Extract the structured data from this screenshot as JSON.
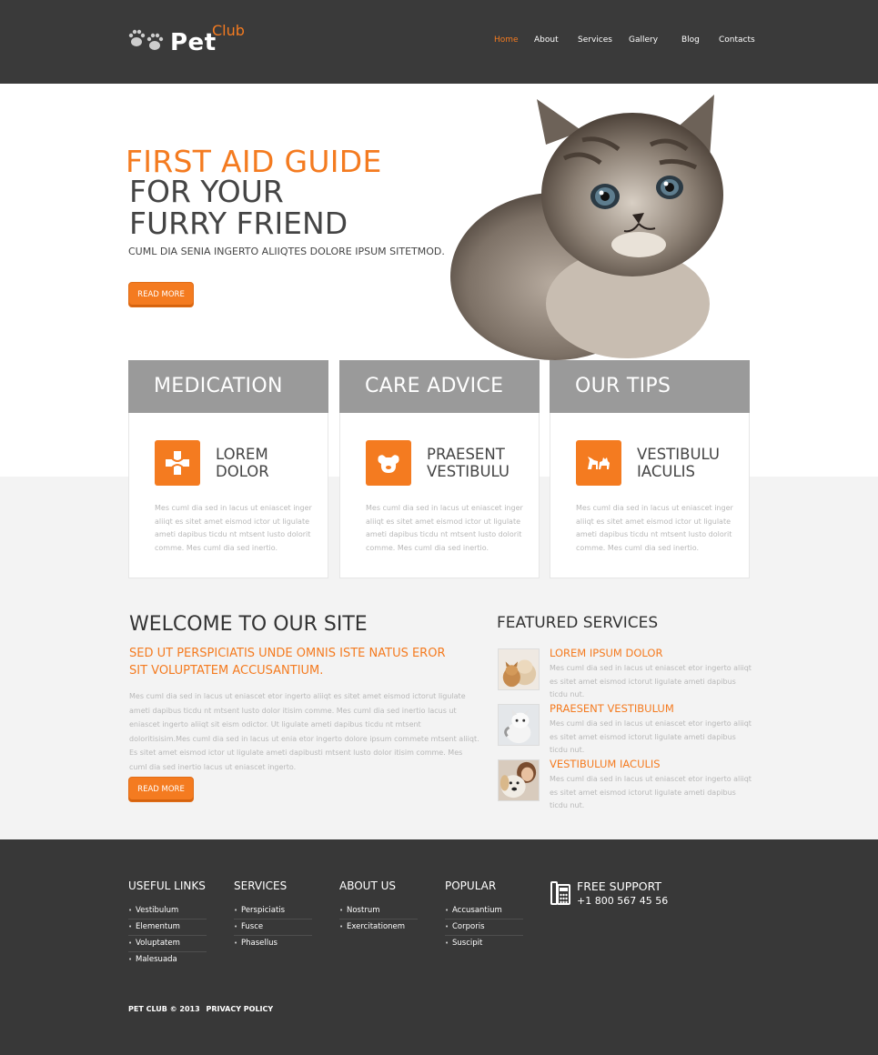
{
  "brand": {
    "name": "Pet",
    "sub": "Club",
    "accent": "#f47b20"
  },
  "nav": {
    "items": [
      "Home",
      "About",
      "Services",
      "Gallery",
      "Blog",
      "Contacts"
    ],
    "active": "Home"
  },
  "hero": {
    "title_orange": "FIRST AID GUIDE",
    "title_line2": "FOR YOUR",
    "title_line3": "FURRY FRIEND",
    "subtitle": "CUML DIA SENIA INGERTO ALIIQTES DOLORE IPSUM SITETMOD.",
    "button": "READ MORE"
  },
  "boxes": [
    {
      "head": "MEDICATION",
      "icon": "medical-cross-icon",
      "sub1": "LOREM",
      "sub2": "DOLOR",
      "text": "Mes cuml dia sed in lacus ut eniascet inger aliiqt es sitet amet eismod ictor ut ligulate ameti dapibus ticdu nt mtsent lusto dolorit comme. Mes cuml dia sed inertio."
    },
    {
      "head": "CARE ADVICE",
      "icon": "dog-face-icon",
      "sub1": "PRAESENT",
      "sub2": "VESTIBULU",
      "text": "Mes cuml dia sed in lacus ut eniascet inger aliiqt es sitet amet eismod ictor ut ligulate ameti dapibus ticdu nt mtsent lusto dolorit comme. Mes cuml dia sed inertio."
    },
    {
      "head": "OUR TIPS",
      "icon": "cat-dog-icon",
      "sub1": "VESTIBULU",
      "sub2": "IACULIS",
      "text": "Mes cuml dia sed in lacus ut eniascet inger aliiqt es sitet amet eismod ictor ut ligulate ameti dapibus ticdu nt mtsent lusto dolorit comme. Mes cuml dia sed inertio."
    }
  ],
  "welcome": {
    "title": "WELCOME TO OUR SITE",
    "subtitle": "SED UT PERSPICIATIS UNDE OMNIS ISTE NATUS EROR SIT VOLUPTATEM ACCUSANTIUM.",
    "text": "Mes cuml dia sed in lacus ut eniascet etor ingerto aliiqt es sitet amet eismod ictorut ligulate ameti dapibus ticdu nt mtsent lusto dolor itisim comme. Mes cuml dia sed inertio lacus ut eniascet ingerto aliiqt sit eism odictor. Ut ligulate ameti dapibus ticdu nt mtsent doloritisisim.Mes cuml dia sed in lacus ut enia etor ingerto dolore ipsum commete mtsent aliiqt. Es sitet amet eismod ictor ut ligulate ameti dapibusti mtsent lusto dolor itisim comme. Mes cuml dia sed inertio lacus ut eniascet ingerto.",
    "button": "READ MORE"
  },
  "featured": {
    "title": "FEATURED SERVICES",
    "items": [
      {
        "name": "LOREM IPSUM DOLOR",
        "text": "Mes cuml dia sed in lacus ut eniascet etor ingerto aliiqt es sitet amet eismod ictorut ligulate ameti dapibus ticdu nut."
      },
      {
        "name": "PRAESENT VESTIBULUM",
        "text": "Mes cuml dia sed in lacus ut eniascet etor ingerto aliiqt es sitet amet eismod ictorut ligulate ameti dapibus ticdu nut."
      },
      {
        "name": "VESTIBULUM IACULIS",
        "text": "Mes cuml dia sed in lacus ut eniascet etor ingerto aliiqt es sitet amet eismod ictorut ligulate ameti dapibus ticdu nut."
      }
    ]
  },
  "footer": {
    "columns": [
      {
        "title": "USEFUL LINKS",
        "links": [
          "Vestibulum",
          "Elementum",
          "Voluptatem",
          "Malesuada"
        ]
      },
      {
        "title": "SERVICES",
        "links": [
          "Perspiciatis",
          "Fusce",
          "Phasellus"
        ]
      },
      {
        "title": "ABOUT US",
        "links": [
          "Nostrum",
          "Exercitationem"
        ]
      },
      {
        "title": "POPULAR",
        "links": [
          "Accusantium",
          "Corporis",
          "Suscipit"
        ]
      }
    ],
    "support": {
      "title": "FREE SUPPORT",
      "phone": "+1 800 567 45 56"
    },
    "copyright": "PET CLUB © 2013",
    "privacy": "PRIVACY POLICY"
  }
}
